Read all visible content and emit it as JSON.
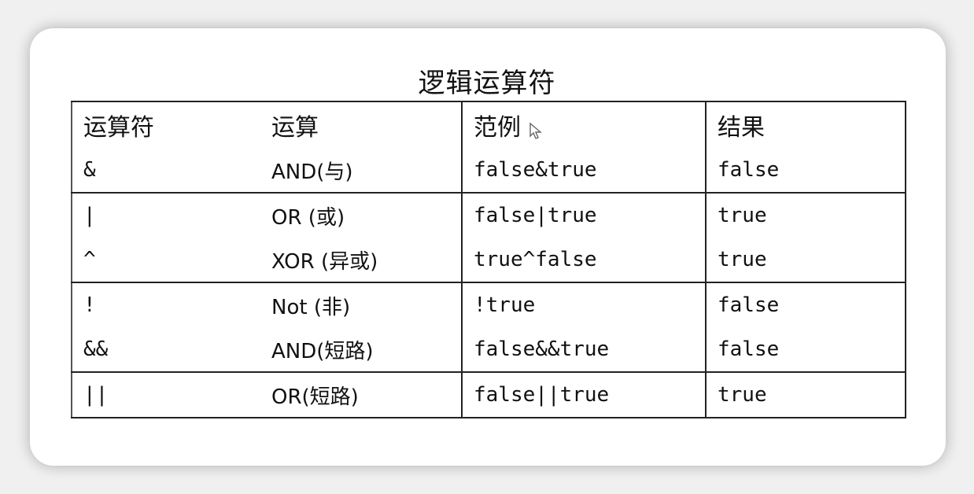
{
  "title": "逻辑运算符",
  "table": {
    "headers": [
      "运算符",
      "运算",
      "范例",
      "结果"
    ],
    "rows": [
      {
        "op": "&",
        "name": "AND(与)",
        "example": "false&true",
        "result": "false"
      },
      {
        "op": "|",
        "name": "OR (或)",
        "example": "false|true",
        "result": "true"
      },
      {
        "op": "^",
        "name": "XOR (异或)",
        "example": "true^false",
        "result": "true"
      },
      {
        "op": "!",
        "name": "Not (非)",
        "example": "!true",
        "result": "false"
      },
      {
        "op": "&&",
        "name": "AND(短路)",
        "example": "false&&true",
        "result": "false"
      },
      {
        "op": "||",
        "name": "OR(短路)",
        "example": "false||true",
        "result": "true"
      }
    ]
  },
  "icons": {
    "cursor": "mouse-pointer-icon"
  }
}
